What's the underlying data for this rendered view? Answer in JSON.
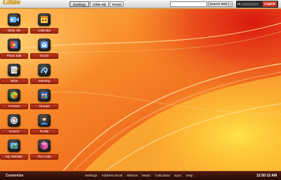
{
  "header": {
    "logo_text": "Glide",
    "tabs": [
      {
        "label": "Desktop",
        "active": true
      },
      {
        "label": "Glide HD",
        "active": false
      },
      {
        "label": "Portal",
        "active": false
      }
    ],
    "search": {
      "value": "",
      "placeholder": "",
      "button_label": "Search Web",
      "dropdown_icon": "chevron-down-icon"
    },
    "user": {
      "greeting": "Hi,",
      "logout_label": "Logout"
    }
  },
  "desktop": {
    "icons": [
      {
        "label": "Glide HD",
        "icon": "video-icon"
      },
      {
        "label": "Calendar",
        "icon": "calendar-icon"
      },
      {
        "label": "Photo Edit",
        "icon": "photo-edit-icon"
      },
      {
        "label": "Email",
        "icon": "email-icon"
      },
      {
        "label": "Write",
        "icon": "write-icon"
      },
      {
        "label": "Meeting",
        "icon": "meeting-icon"
      },
      {
        "label": "Present",
        "icon": "present-icon"
      },
      {
        "label": "Groups",
        "icon": "groups-icon"
      },
      {
        "label": "Crunch",
        "icon": "crunch-icon"
      },
      {
        "label": "Profile",
        "icon": "profile-icon"
      },
      {
        "label": "My Website",
        "icon": "website-icon"
      },
      {
        "label": "The Cube",
        "icon": "cube-icon"
      }
    ]
  },
  "taskbar": {
    "customize_label": "Customize",
    "links": [
      "Settings",
      "Address Book",
      "Slideos",
      "Music",
      "Calculator",
      "Sync",
      "Help"
    ],
    "clock": "12:50:12 AM"
  },
  "colors": {
    "wallpaper_light": "#ffd23c",
    "wallpaper_dark": "#e83a18",
    "label_red": "#b8301a",
    "taskbar": "#3a1208"
  }
}
